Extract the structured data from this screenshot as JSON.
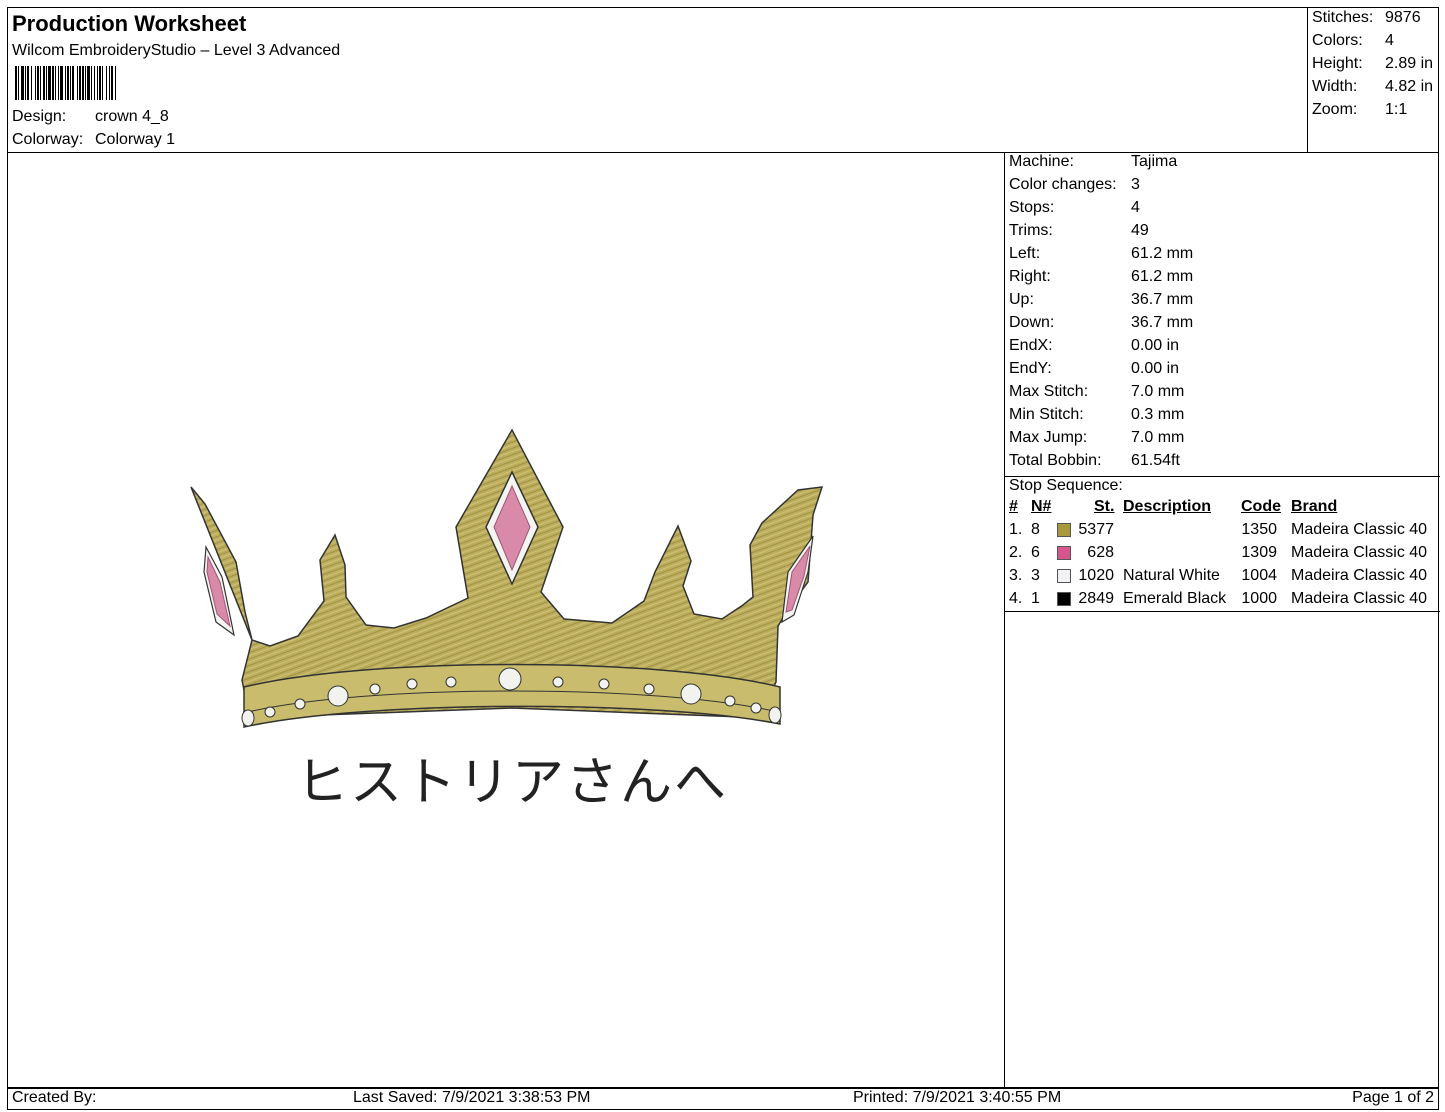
{
  "header": {
    "title": "Production Worksheet",
    "software": "Wilcom EmbroideryStudio – Level 3 Advanced",
    "design_label": "Design:",
    "design_value": "crown 4_8",
    "colorway_label": "Colorway:",
    "colorway_value": "Colorway 1"
  },
  "summary": [
    {
      "label": "Stitches:",
      "value": "9876"
    },
    {
      "label": "Colors:",
      "value": "4"
    },
    {
      "label": "Height:",
      "value": "2.89 in"
    },
    {
      "label": "Width:",
      "value": "4.82 in"
    },
    {
      "label": "Zoom:",
      "value": "1:1"
    }
  ],
  "machine_info": [
    {
      "label": "Machine:",
      "value": "Tajima"
    },
    {
      "label": "Color changes:",
      "value": "3"
    },
    {
      "label": "Stops:",
      "value": "4"
    },
    {
      "label": "Trims:",
      "value": "49"
    },
    {
      "label": "Left:",
      "value": "61.2 mm"
    },
    {
      "label": "Right:",
      "value": "61.2 mm"
    },
    {
      "label": "Up:",
      "value": "36.7 mm"
    },
    {
      "label": "Down:",
      "value": "36.7 mm"
    },
    {
      "label": "EndX:",
      "value": "0.00 in"
    },
    {
      "label": "EndY:",
      "value": "0.00 in"
    },
    {
      "label": "Max Stitch:",
      "value": "7.0 mm"
    },
    {
      "label": "Min Stitch:",
      "value": "0.3 mm"
    },
    {
      "label": "Max Jump:",
      "value": "7.0 mm"
    },
    {
      "label": "Total Bobbin:",
      "value": "61.54ft"
    }
  ],
  "stop_sequence": {
    "title": "Stop Sequence:",
    "headers": {
      "num": "#",
      "needle": "N#",
      "stitch": "St.",
      "description": "Description",
      "code": "Code",
      "brand": "Brand"
    },
    "rows": [
      {
        "num": "1.",
        "needle": "8",
        "color": "#a89a3c",
        "stitch": "5377",
        "description": "",
        "code": "1350",
        "brand": "Madeira Classic 40"
      },
      {
        "num": "2.",
        "needle": "6",
        "color": "#d4568a",
        "stitch": "628",
        "description": "",
        "code": "1309",
        "brand": "Madeira Classic 40"
      },
      {
        "num": "3.",
        "needle": "3",
        "color": "#f2f2f6",
        "stitch": "1020",
        "description": "Natural White",
        "code": "1004",
        "brand": "Madeira Classic 40"
      },
      {
        "num": "4.",
        "needle": "1",
        "color": "#000000",
        "stitch": "2849",
        "description": "Emerald Black",
        "code": "1000",
        "brand": "Madeira Classic 40"
      }
    ]
  },
  "design_text": "ヒストリアさんへ",
  "footer": {
    "created_by": "Created By:",
    "last_saved": "Last Saved: 7/9/2021 3:38:53 PM",
    "printed": "Printed: 7/9/2021 3:40:55 PM",
    "page": "Page 1 of 2"
  }
}
